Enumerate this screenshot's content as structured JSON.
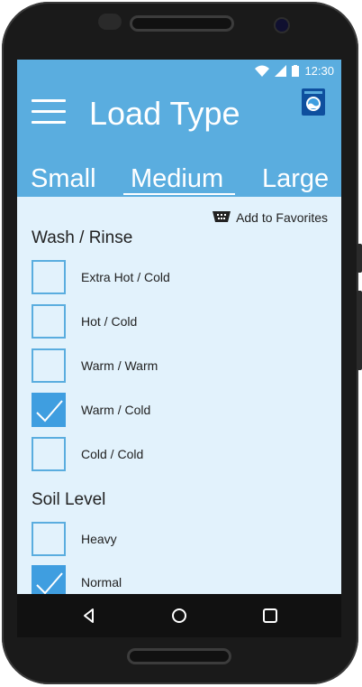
{
  "status_bar": {
    "time": "12:30"
  },
  "header": {
    "title": "Load Type",
    "tabs": [
      {
        "label": "Small",
        "selected": false
      },
      {
        "label": "Medium",
        "selected": true
      },
      {
        "label": "Large",
        "selected": false
      }
    ]
  },
  "favorites": {
    "label": "Add to Favorites"
  },
  "wash_rinse": {
    "title": "Wash / Rinse",
    "options": [
      {
        "label": "Extra Hot / Cold",
        "checked": false
      },
      {
        "label": "Hot / Cold",
        "checked": false
      },
      {
        "label": "Warm / Warm",
        "checked": false
      },
      {
        "label": "Warm / Cold",
        "checked": true
      },
      {
        "label": "Cold / Cold",
        "checked": false
      }
    ]
  },
  "soil_level": {
    "title": "Soil Level",
    "options": [
      {
        "label": "Heavy",
        "checked": false
      },
      {
        "label": "Normal",
        "checked": true
      }
    ]
  },
  "colors": {
    "accent": "#5aaddf",
    "checked": "#3f9ee0",
    "background": "#e2f2fc"
  }
}
